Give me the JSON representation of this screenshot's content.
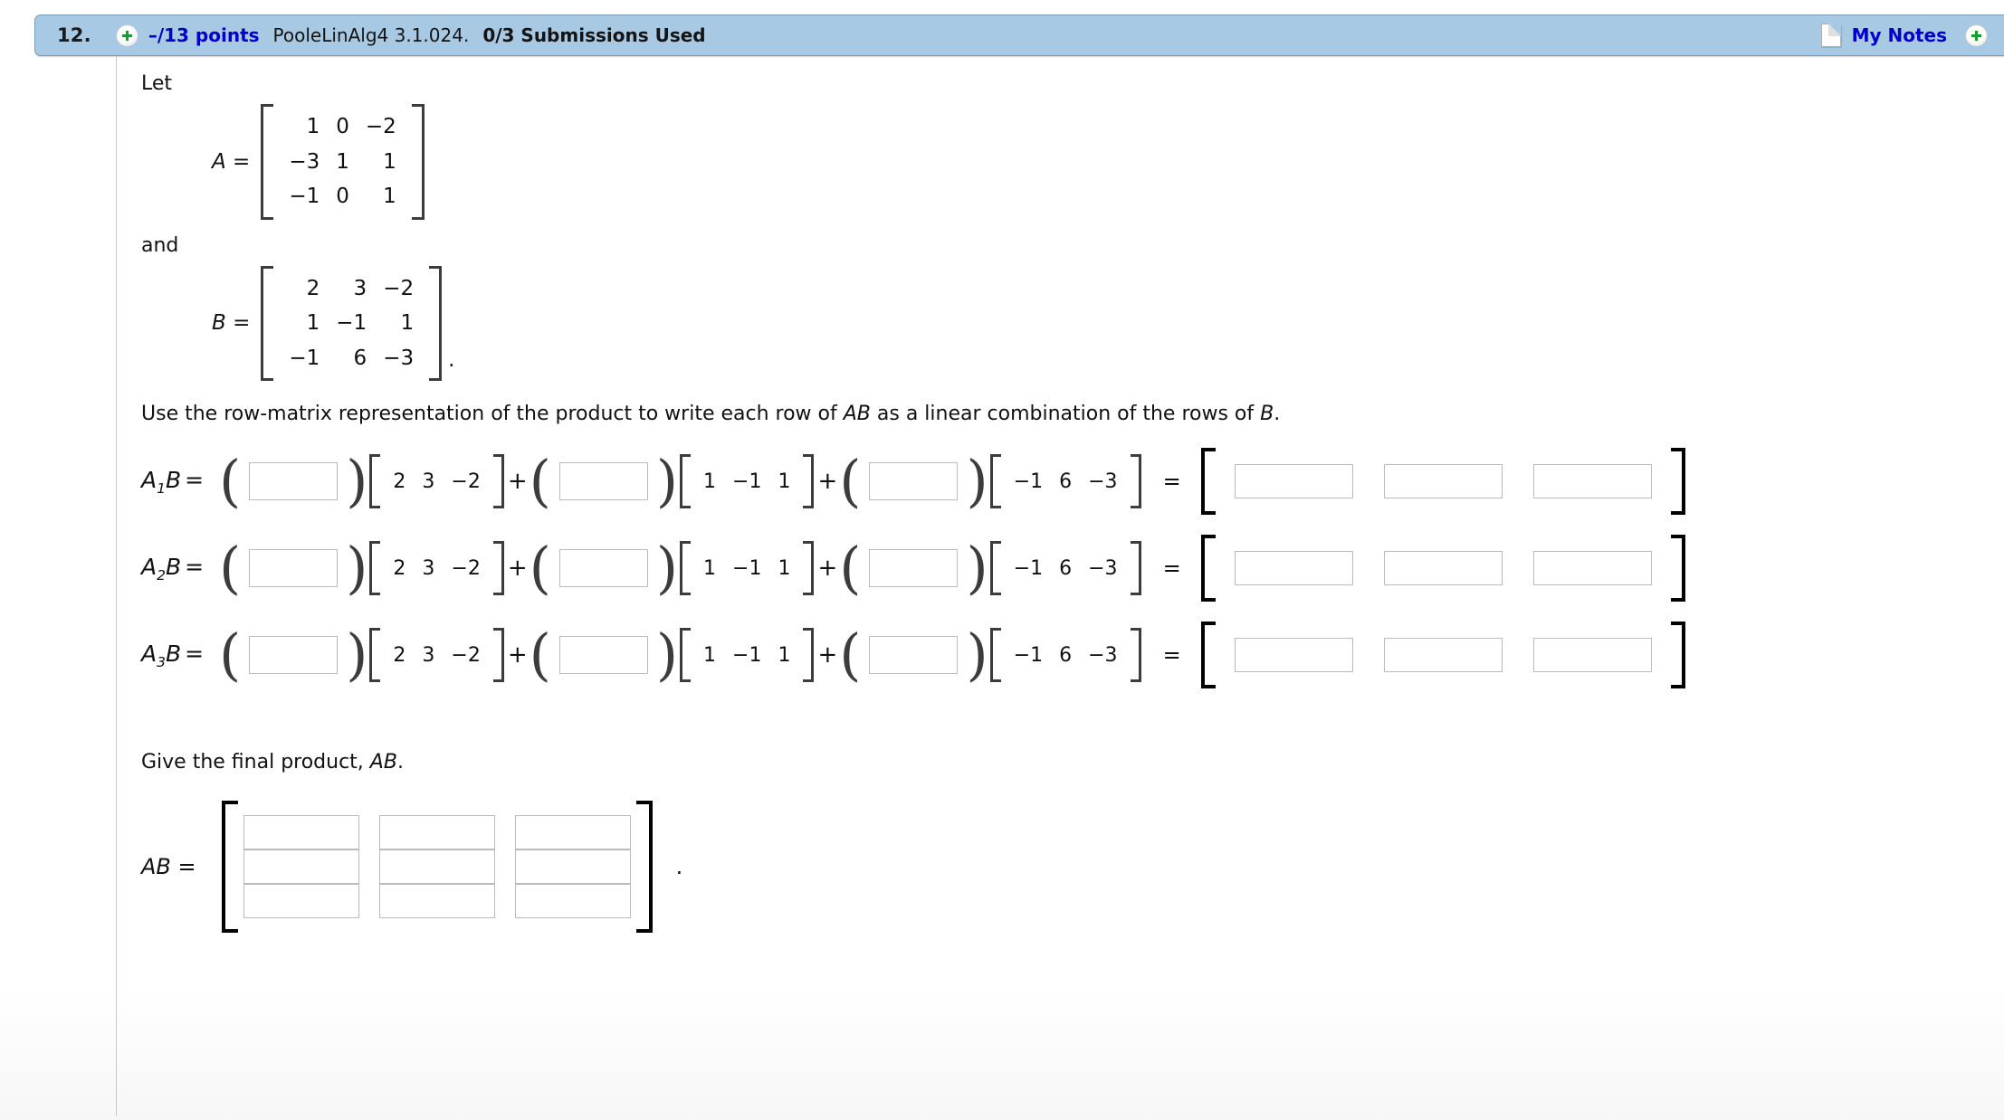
{
  "header": {
    "question_number": "12.",
    "expand_icon": "plus-circle-icon",
    "points": "–/13 points",
    "textbook_code": "PooleLinAlg4 3.1.024.",
    "submissions": "0/3 Submissions Used",
    "notes_icon": "note-page-icon",
    "notes_label": "My Notes",
    "notes_plus_icon": "plus-circle-icon",
    "bg_color": "#a8c9e3",
    "link_color": "#0000cc"
  },
  "body": {
    "let_text": "Let",
    "and_text": "and",
    "instruction": "Use the row-matrix representation of the product to write each row of AB as a linear combination of the rows of B.",
    "instruction_parts": {
      "p1": "Use the row-matrix representation of the product to write each row of ",
      "em1": "AB",
      "p2": " as a linear combination of the rows of ",
      "em2": "B",
      "p3": "."
    },
    "final_question_parts": {
      "p1": "Give the final product, ",
      "em1": "AB",
      "p2": "."
    }
  },
  "matrix_A": {
    "label": "A =",
    "rows": [
      [
        {
          "v": "1",
          "red": false
        },
        {
          "v": "0",
          "red": false
        },
        {
          "v": "−2",
          "red": false
        }
      ],
      [
        {
          "v": "−3",
          "red": false
        },
        {
          "v": "1",
          "red": false
        },
        {
          "v": "1",
          "red": false
        }
      ],
      [
        {
          "v": "−1",
          "red": true
        },
        {
          "v": "0",
          "red": true
        },
        {
          "v": "1",
          "red": true
        }
      ]
    ]
  },
  "matrix_B": {
    "label": "B =",
    "trailing": ".",
    "rows": [
      [
        {
          "v": "2",
          "red": false
        },
        {
          "v": "3",
          "red": false
        },
        {
          "v": "−2",
          "red": true
        }
      ],
      [
        {
          "v": "1",
          "red": false
        },
        {
          "v": "−1",
          "red": false
        },
        {
          "v": "1",
          "red": true
        }
      ],
      [
        {
          "v": "−1",
          "red": false
        },
        {
          "v": "6",
          "red": false
        },
        {
          "v": "−3",
          "red": true
        }
      ]
    ]
  },
  "row_vectors": [
    {
      "cells": [
        {
          "v": "2",
          "red": false
        },
        {
          "v": "3",
          "red": false
        },
        {
          "v": "−2",
          "red": true
        }
      ]
    },
    {
      "cells": [
        {
          "v": "1",
          "red": false
        },
        {
          "v": "−1",
          "red": false
        },
        {
          "v": "1",
          "red": true
        }
      ]
    },
    {
      "cells": [
        {
          "v": "−1",
          "red": false
        },
        {
          "v": "6",
          "red": false
        },
        {
          "v": "−3",
          "red": true
        }
      ]
    }
  ],
  "equations": [
    {
      "label_base": "A",
      "label_sub": "1",
      "label_tail": "B",
      "equals": "=",
      "coef_values": [
        "",
        "",
        ""
      ],
      "answer_values": [
        "",
        "",
        ""
      ]
    },
    {
      "label_base": "A",
      "label_sub": "2",
      "label_tail": "B",
      "equals": "=",
      "coef_values": [
        "",
        "",
        ""
      ],
      "answer_values": [
        "",
        "",
        ""
      ]
    },
    {
      "label_base": "A",
      "label_sub": "3",
      "label_tail": "B",
      "equals": "=",
      "coef_values": [
        "",
        "",
        ""
      ],
      "answer_values": [
        "",
        "",
        ""
      ]
    }
  ],
  "operators": {
    "plus": "+",
    "equals": "=",
    "open_paren": "(",
    "close_paren": ")"
  },
  "final_product": {
    "label": "AB =",
    "trailing": ".",
    "values": [
      [
        "",
        "",
        ""
      ],
      [
        "",
        "",
        ""
      ],
      [
        "",
        "",
        ""
      ]
    ]
  }
}
